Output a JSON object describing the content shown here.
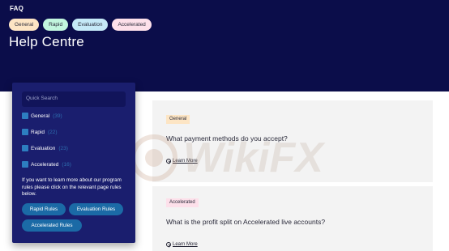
{
  "header": {
    "faq": "FAQ",
    "title": "Help Centre",
    "pills": [
      "General",
      "Rapid",
      "Evaluation",
      "Accelerated"
    ]
  },
  "sidebar": {
    "search_placeholder": "Quick Search",
    "categories": [
      {
        "name": "General",
        "count": "(39)"
      },
      {
        "name": "Rapid",
        "count": "(22)"
      },
      {
        "name": "Evaluation",
        "count": "(23)"
      },
      {
        "name": "Accelerated",
        "count": "(16)"
      }
    ],
    "info_text": "If you want to learn more about our program rules please click on the relevant page rules below.",
    "buttons": [
      "Rapid Rules",
      "Evaluation Rules",
      "Accelerated Rules"
    ]
  },
  "faq_cards": [
    {
      "tag": "General",
      "question": "What payment methods do you accept?",
      "link": "Learn More"
    },
    {
      "tag": "Accelerated",
      "question": "What is the profit split on Accelerated live accounts?",
      "link": "Learn More"
    }
  ],
  "watermark": "WikiFX",
  "colors": {
    "hero_bg": "#0b0d4a",
    "panel_bg": "#1a1e6e",
    "button_bg": "#1b6aa6"
  }
}
